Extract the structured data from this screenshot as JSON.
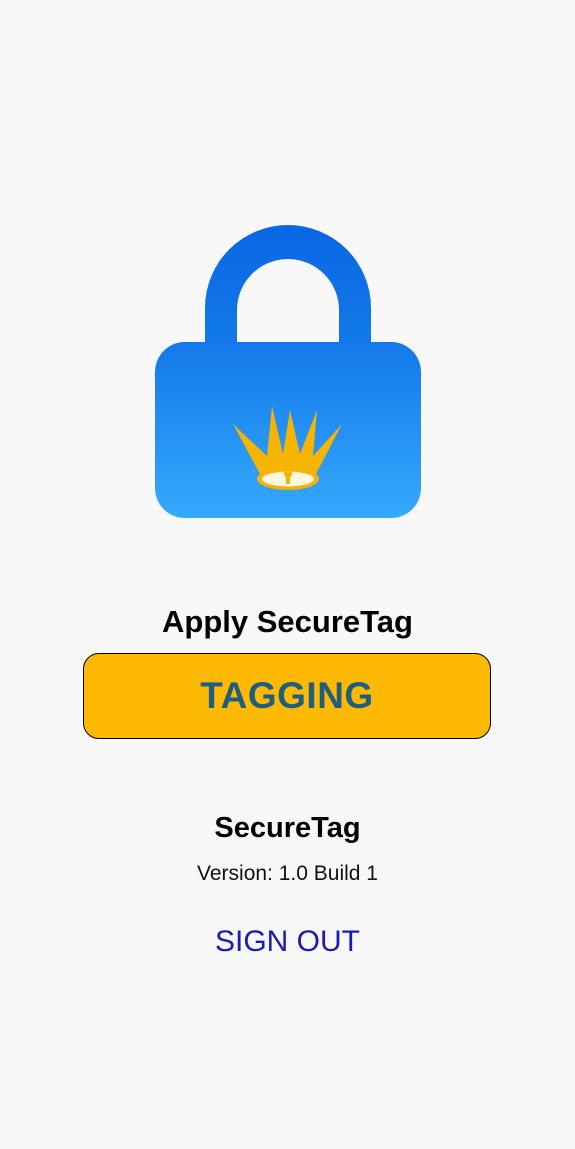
{
  "colors": {
    "background": "#f8f8f8",
    "lock_top": "#0a6ee6",
    "lock_bottom": "#37a8fb",
    "crown": "#f5b400",
    "button_fill": "#fdb903",
    "button_text": "#1e5f80",
    "sign_out_text": "#1a1ab8"
  },
  "logo": {
    "icon": "padlock-with-crown-icon"
  },
  "main": {
    "apply_label": "Apply SecureTag",
    "tagging_button_label": "TAGGING"
  },
  "about": {
    "app_name": "SecureTag",
    "version": "Version: 1.0 Build 1"
  },
  "account": {
    "sign_out_label": "SIGN OUT"
  }
}
